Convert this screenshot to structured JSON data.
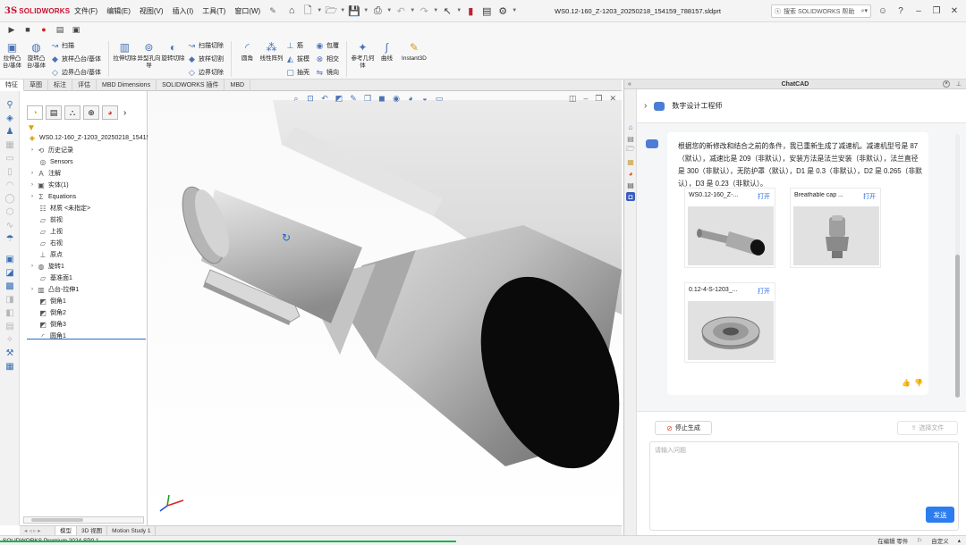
{
  "app": {
    "logo_ds": "3S",
    "logo_text": "SOLIDWORKS",
    "menus": [
      "文件(F)",
      "编辑(E)",
      "视图(V)",
      "插入(I)",
      "工具(T)",
      "窗口(W)"
    ],
    "document_title": "WS0.12-160_Z-1203_20250218_154159_788157.sldprt",
    "help_search_placeholder": "搜索 SOLIDWORKS 帮助"
  },
  "ribbon": {
    "big_buttons": [
      {
        "label": "拉伸凸台/基体",
        "icon": "extrude-boss-icon"
      },
      {
        "label": "旋转凸台/基体",
        "icon": "revolve-boss-icon"
      }
    ],
    "small_col1": [
      "扫描",
      "放样凸台/基体",
      "边界凸台/基体"
    ],
    "big_buttons2": [
      {
        "label": "拉伸切除",
        "icon": "extrude-cut-icon"
      },
      {
        "label": "异型孔向导",
        "icon": "hole-wizard-icon"
      },
      {
        "label": "旋转切除",
        "icon": "revolve-cut-icon"
      }
    ],
    "small_col2": [
      "扫描切除",
      "放样切割",
      "边界切除"
    ],
    "big_buttons3": [
      {
        "label": "圆角",
        "icon": "fillet-icon"
      },
      {
        "label": "线性阵列",
        "icon": "linear-pattern-icon"
      }
    ],
    "small_col3": [
      "筋",
      "拔模",
      "抽壳"
    ],
    "small_col4": [
      "包覆",
      "相交",
      "镜向"
    ],
    "big_buttons4": [
      {
        "label": "参考几何体",
        "icon": "reference-geometry-icon"
      },
      {
        "label": "曲线",
        "icon": "curves-icon"
      },
      {
        "label": "Instant3D",
        "icon": "instant3d-icon"
      }
    ]
  },
  "command_tabs": [
    "特征",
    "草图",
    "标注",
    "评估",
    "MBD Dimensions",
    "SOLIDWORKS 插件",
    "MBD"
  ],
  "active_command_tab": "特征",
  "feature_tree": {
    "root": "WS0.12-160_Z-1203_20250218_15415",
    "nodes": [
      {
        "label": "历史记录",
        "icon": "history-icon",
        "expandable": true
      },
      {
        "label": "Sensors",
        "icon": "sensor-icon",
        "expandable": false
      },
      {
        "label": "注解",
        "icon": "annotation-icon",
        "expandable": true
      },
      {
        "label": "实体(1)",
        "icon": "solid-body-icon",
        "expandable": true
      },
      {
        "label": "Equations",
        "icon": "equation-icon",
        "expandable": true
      },
      {
        "label": "材质 <未指定>",
        "icon": "material-icon",
        "expandable": false
      },
      {
        "label": "前视",
        "icon": "plane-icon",
        "expandable": false
      },
      {
        "label": "上视",
        "icon": "plane-icon",
        "expandable": false
      },
      {
        "label": "右视",
        "icon": "plane-icon",
        "expandable": false
      },
      {
        "label": "原点",
        "icon": "origin-icon",
        "expandable": false
      },
      {
        "label": "旋转1",
        "icon": "revolve-feature-icon",
        "expandable": true
      },
      {
        "label": "基准面1",
        "icon": "plane-icon",
        "expandable": false
      },
      {
        "label": "凸台-拉伸1",
        "icon": "extrude-feature-icon",
        "expandable": true
      },
      {
        "label": "倒角1",
        "icon": "chamfer-icon",
        "expandable": false
      },
      {
        "label": "倒角2",
        "icon": "chamfer-icon",
        "expandable": false
      },
      {
        "label": "倒角3",
        "icon": "chamfer-icon",
        "expandable": false
      },
      {
        "label": "圆角1",
        "icon": "fillet-feature-icon",
        "expandable": false
      }
    ]
  },
  "bottom_tabs": [
    "模型",
    "3D 视图",
    "Motion Study 1"
  ],
  "active_bottom_tab": "模型",
  "status": {
    "left": "SOLIDWORKS Premium 2024 SP0.1",
    "editing": "在编辑 零件",
    "units": "自定义"
  },
  "chatcad": {
    "title": "ChatCAD",
    "agent_name": "数字设计工程师",
    "message": "根据您的新修改和结合之前的条件，我已重新生成了减速机。减速机型号是 87（默认），减速比是 209（非默认），安装方法是法兰安装（非默认），法兰直径是 300（非默认），无防护罩（默认），D1 是 0.3（非默认），D2 是 0.265（非默认），D3 是 0.23（非默认）。",
    "cards": [
      {
        "title": "WS0.12-160_Z-...",
        "open": "打开",
        "image": "shaft-part-icon"
      },
      {
        "title": "Breathable cap ...",
        "open": "打开",
        "image": "breather-cap-icon"
      },
      {
        "title": "0.12-4-S-1203_...",
        "open": "打开",
        "image": "flange-gear-icon"
      }
    ],
    "stop_label": "停止生成",
    "file_label": "选择文件",
    "input_placeholder": "请输入问题",
    "send_label": "发送"
  },
  "colors": {
    "accent": "#2b7df0",
    "brand_red": "#c8102e",
    "status_green": "#17b350"
  }
}
